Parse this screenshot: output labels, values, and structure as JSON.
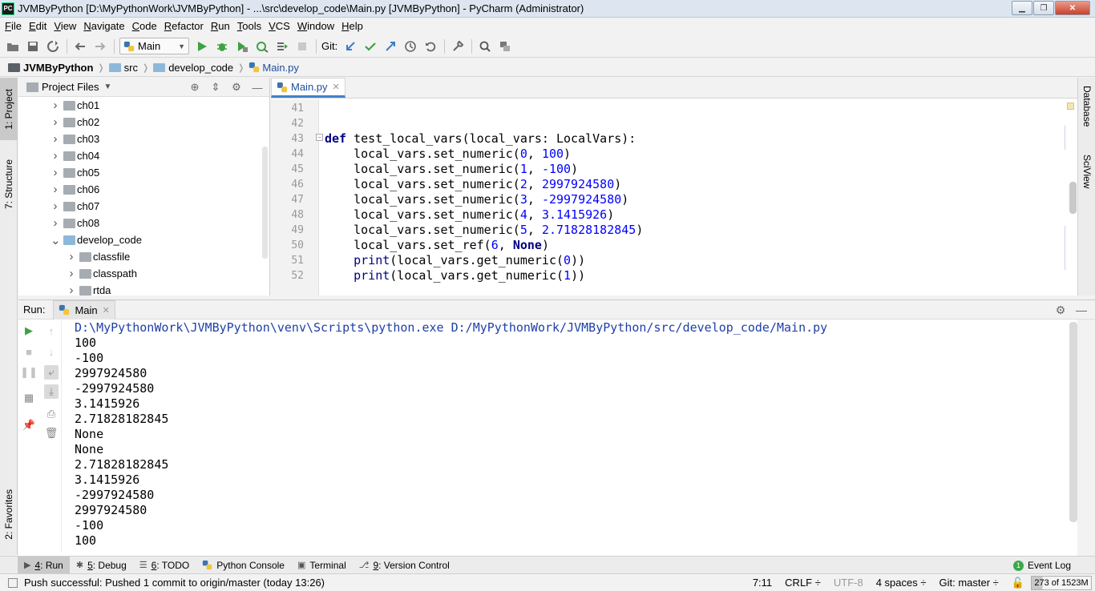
{
  "window": {
    "title": "JVMByPython [D:\\MyPythonWork\\JVMByPython] - ...\\src\\develop_code\\Main.py [JVMByPython] - PyCharm (Administrator)",
    "app_icon": "PC"
  },
  "menu": [
    "File",
    "Edit",
    "View",
    "Navigate",
    "Code",
    "Refactor",
    "Run",
    "Tools",
    "VCS",
    "Window",
    "Help"
  ],
  "toolbar": {
    "run_config": "Main",
    "git_label": "Git:"
  },
  "breadcrumb": [
    "JVMByPython",
    "src",
    "develop_code",
    "Main.py"
  ],
  "left_tabs": {
    "project": "1: Project",
    "structure": "7: Structure",
    "favorites": "2: Favorites"
  },
  "right_tabs": {
    "database": "Database",
    "sciview": "SciView"
  },
  "project_panel": {
    "title": "Project Files",
    "items": [
      {
        "label": "ch01",
        "expanded": false,
        "level": 1
      },
      {
        "label": "ch02",
        "expanded": false,
        "level": 1
      },
      {
        "label": "ch03",
        "expanded": false,
        "level": 1
      },
      {
        "label": "ch04",
        "expanded": false,
        "level": 1
      },
      {
        "label": "ch05",
        "expanded": false,
        "level": 1
      },
      {
        "label": "ch06",
        "expanded": false,
        "level": 1
      },
      {
        "label": "ch07",
        "expanded": false,
        "level": 1
      },
      {
        "label": "ch08",
        "expanded": false,
        "level": 1
      },
      {
        "label": "develop_code",
        "expanded": true,
        "level": 1
      },
      {
        "label": "classfile",
        "expanded": false,
        "level": 2
      },
      {
        "label": "classpath",
        "expanded": false,
        "level": 2
      },
      {
        "label": "rtda",
        "expanded": false,
        "level": 2
      }
    ]
  },
  "editor": {
    "tab": "Main.py",
    "line_numbers": [
      "41",
      "42",
      "43",
      "44",
      "45",
      "46",
      "47",
      "48",
      "49",
      "50",
      "51",
      "52"
    ],
    "code_lines": [
      "",
      "",
      "def test_local_vars(local_vars: LocalVars):",
      "    local_vars.set_numeric(0, 100)",
      "    local_vars.set_numeric(1, -100)",
      "    local_vars.set_numeric(2, 2997924580)",
      "    local_vars.set_numeric(3, -2997924580)",
      "    local_vars.set_numeric(4, 3.1415926)",
      "    local_vars.set_numeric(5, 2.71828182845)",
      "    local_vars.set_ref(6, None)",
      "    print(local_vars.get_numeric(0))",
      "    print(local_vars.get_numeric(1))"
    ]
  },
  "run_panel": {
    "label": "Run:",
    "tab": "Main",
    "output": [
      "D:\\MyPythonWork\\JVMByPython\\venv\\Scripts\\python.exe D:/MyPythonWork/JVMByPython/src/develop_code/Main.py",
      "100",
      "-100",
      "2997924580",
      "-2997924580",
      "3.1415926",
      "2.71828182845",
      "None",
      "None",
      "2.71828182845",
      "3.1415926",
      "-2997924580",
      "2997924580",
      "-100",
      "100"
    ]
  },
  "tool_windows": [
    {
      "key": "4",
      "label": ": Run",
      "icon": "run-icon"
    },
    {
      "key": "5",
      "label": ": Debug",
      "icon": "bug-icon"
    },
    {
      "key": "6",
      "label": ": TODO",
      "icon": "todo-icon"
    },
    {
      "key": "",
      "label": "Python Console",
      "icon": "python-icon"
    },
    {
      "key": "",
      "label": "Terminal",
      "icon": "terminal-icon"
    },
    {
      "key": "9",
      "label": ": Version Control",
      "icon": "vcs-icon"
    }
  ],
  "event_log": {
    "label": "Event Log",
    "count": "1"
  },
  "status": {
    "message": "Push successful: Pushed 1 commit to origin/master (today 13:26)",
    "position": "7:11",
    "line_sep": "CRLF ÷",
    "encoding": "UTF-8",
    "indent": "4 spaces ÷",
    "vcs": "Git: master ÷",
    "memory": "273 of 1523M",
    "memory_used_fraction": 0.18
  },
  "colors": {
    "keyword": "#000080",
    "number": "#0000ff",
    "console_command": "#1f3fa8",
    "accent": "#4083c9"
  }
}
